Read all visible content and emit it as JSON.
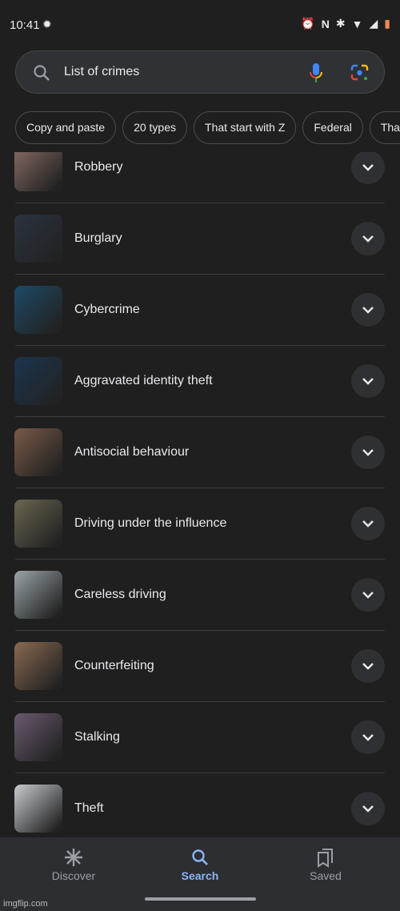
{
  "status_bar": {
    "time": "10:41"
  },
  "search": {
    "query": "List of crimes"
  },
  "chips": [
    "Copy and paste",
    "20 types",
    "That start with Z",
    "Federal",
    "That"
  ],
  "items": [
    {
      "label": "Robbery",
      "color": "#8a6e66"
    },
    {
      "label": "Burglary",
      "color": "#2a3340"
    },
    {
      "label": "Cybercrime",
      "color": "#1d4a66"
    },
    {
      "label": "Aggravated identity theft",
      "color": "#1b3550"
    },
    {
      "label": "Antisocial behaviour",
      "color": "#7a5a48"
    },
    {
      "label": "Driving under the influence",
      "color": "#6a6650"
    },
    {
      "label": "Careless driving",
      "color": "#9aa4a8"
    },
    {
      "label": "Counterfeiting",
      "color": "#8a6a50"
    },
    {
      "label": "Stalking",
      "color": "#6a5a70"
    },
    {
      "label": "Theft",
      "color": "#c8ccd0"
    }
  ],
  "nav": {
    "discover": "Discover",
    "search": "Search",
    "saved": "Saved",
    "active_color": "#8ab4f8"
  },
  "watermark": "imgflip.com"
}
